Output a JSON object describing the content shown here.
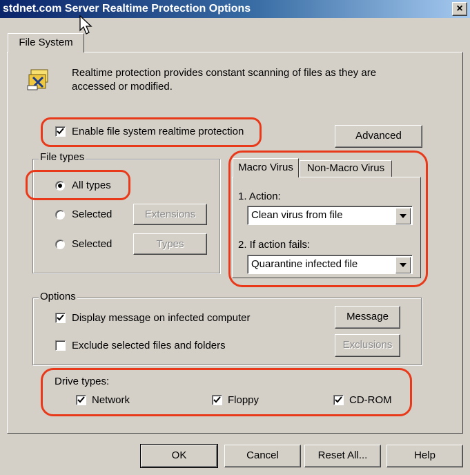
{
  "window": {
    "title": "stdnet.com Server Realtime Protection Options",
    "close_label": "×"
  },
  "tabs": {
    "file_system": "File System"
  },
  "intro": {
    "text_line1": "Realtime protection provides constant scanning of files as they are",
    "text_line2": "accessed or modified."
  },
  "enable_protection": {
    "label": "Enable file system realtime protection",
    "checked": true
  },
  "advanced_button": "Advanced",
  "file_types": {
    "group_label": "File types",
    "options": [
      {
        "label": "All types",
        "selected": true
      },
      {
        "label": "Selected",
        "selected": false,
        "button": "Extensions",
        "button_enabled": false
      },
      {
        "label": "Selected",
        "selected": false,
        "button": "Types",
        "button_enabled": false
      }
    ]
  },
  "virus_tabs": {
    "tabs": [
      "Macro Virus",
      "Non-Macro Virus"
    ],
    "active_tab": "Macro Virus",
    "action_label": "1. Action:",
    "action_value": "Clean virus from file",
    "fail_label": "2. If action fails:",
    "fail_value": "Quarantine infected file"
  },
  "options": {
    "group_label": "Options",
    "display_message": {
      "label": "Display message on infected computer",
      "checked": true
    },
    "message_button": "Message",
    "exclude": {
      "label": "Exclude selected files and folders",
      "checked": false
    },
    "exclusions_button": "Exclusions"
  },
  "drive_types": {
    "label": "Drive types:",
    "items": [
      {
        "label": "Network",
        "checked": true
      },
      {
        "label": "Floppy",
        "checked": true
      },
      {
        "label": "CD-ROM",
        "checked": true
      }
    ]
  },
  "footer_buttons": {
    "ok": "OK",
    "cancel": "Cancel",
    "reset_all": "Reset All...",
    "help": "Help"
  },
  "colors": {
    "annotation": "#e83a1a",
    "dialog_face": "#d4d0c8",
    "title_start": "#0a246a",
    "title_end": "#a6caf0"
  }
}
